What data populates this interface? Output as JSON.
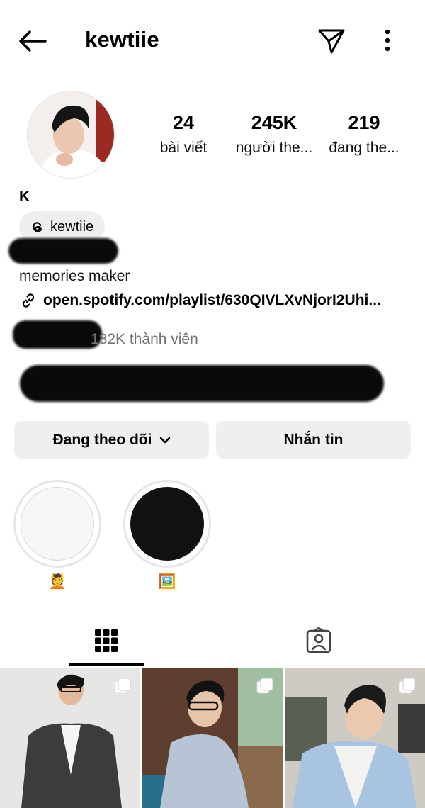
{
  "header": {
    "username": "kewtiie",
    "icons": {
      "back": "back-arrow-icon",
      "send": "send-icon",
      "more": "more-vertical-icon"
    }
  },
  "profile": {
    "display_name": "K",
    "stats": {
      "posts": {
        "value": "24",
        "label": "bài viết"
      },
      "followers": {
        "value": "245K",
        "label": "người the..."
      },
      "following": {
        "value": "219",
        "label": "đang the..."
      }
    },
    "threads_handle": "kewtiie",
    "bio": "memories maker",
    "link": "open.spotify.com/playlist/630QIVLXvNjorI2Uhi...",
    "channel_members": "182K thành viên"
  },
  "actions": {
    "following_label": "Đang theo dõi",
    "message_label": "Nhắn tin"
  },
  "highlights": [
    {
      "label": "💆"
    },
    {
      "label": "🖼️"
    }
  ],
  "tabs": [
    {
      "icon": "grid-icon",
      "active": true
    },
    {
      "icon": "tagged-person-icon",
      "active": false
    }
  ],
  "colors": {
    "button_bg": "#efefef",
    "muted_text": "#737373"
  }
}
